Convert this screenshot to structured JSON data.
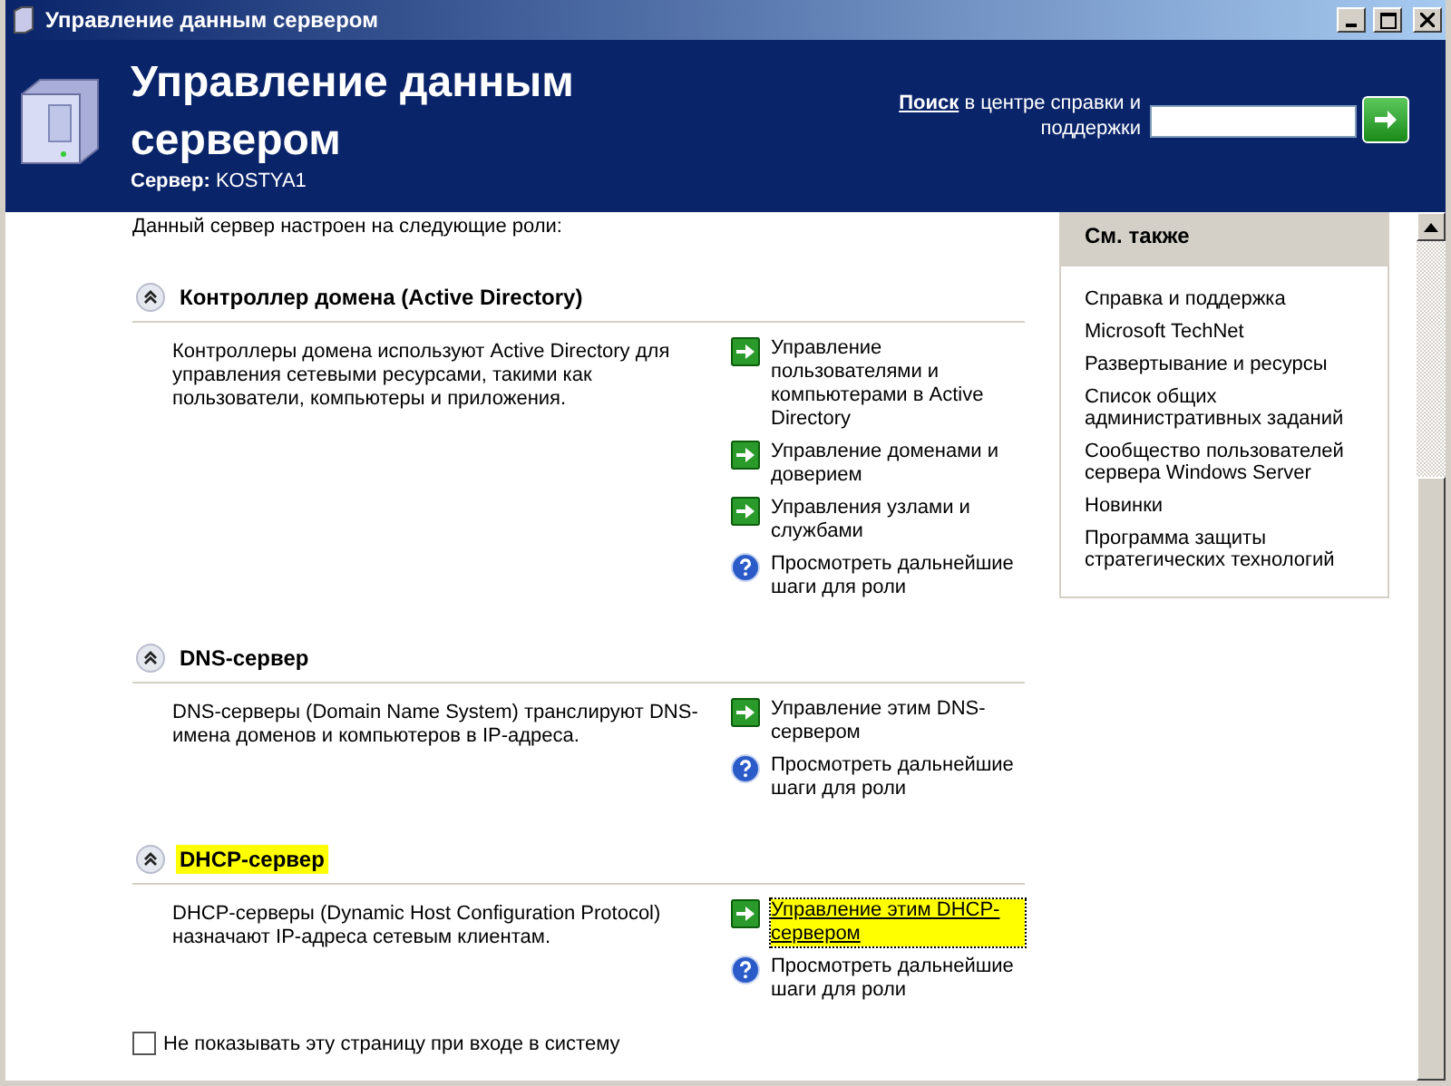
{
  "window": {
    "title": "Управление данным сервером"
  },
  "header": {
    "title": "Управление данным сервером",
    "server_label": "Сервер:",
    "server_name": "KOSTYA1",
    "search_label": "Поиск",
    "search_hint": "в центре справки и поддержки"
  },
  "intro": "Данный сервер настроен на следующие роли:",
  "roles": [
    {
      "title": "Контроллер домена (Active Directory)",
      "expanded": true,
      "highlighted": false,
      "description": "Контроллеры домена используют Active Directory для управления сетевыми ресурсами, такими как пользователи, компьютеры и приложения.",
      "actions": [
        {
          "kind": "manage",
          "label": "Управление пользователями и компьютерами в Active Directory",
          "highlighted": false
        },
        {
          "kind": "manage",
          "label": "Управление доменами и доверием",
          "highlighted": false
        },
        {
          "kind": "manage",
          "label": "Управления узлами и службами",
          "highlighted": false
        },
        {
          "kind": "help",
          "label": "Просмотреть дальнейшие шаги для роли",
          "highlighted": false
        }
      ]
    },
    {
      "title": "DNS-сервер",
      "expanded": true,
      "highlighted": false,
      "description": "DNS-серверы (Domain Name System) транслируют DNS-имена доменов и компьютеров в IP-адреса.",
      "actions": [
        {
          "kind": "manage",
          "label": "Управление этим DNS-сервером",
          "highlighted": false
        },
        {
          "kind": "help",
          "label": "Просмотреть дальнейшие шаги для роли",
          "highlighted": false
        }
      ]
    },
    {
      "title": "DHCP-сервер",
      "expanded": true,
      "highlighted": true,
      "description": "DHCP-серверы (Dynamic Host Configuration Protocol) назначают IP-адреса сетевым клиентам.",
      "actions": [
        {
          "kind": "manage",
          "label": "Управление этим DHCP-сервером",
          "highlighted": true
        },
        {
          "kind": "help",
          "label": "Просмотреть дальнейшие шаги для роли",
          "highlighted": false
        }
      ]
    }
  ],
  "dont_show": {
    "label": "Не показывать эту страницу при входе в систему",
    "checked": false
  },
  "see_also": {
    "title": "См. также",
    "links": [
      "Справка и поддержка",
      "Microsoft TechNet",
      "Развертывание и ресурсы",
      "Список общих административных заданий",
      "Сообщество пользователей сервера Windows Server",
      "Новинки",
      "Программа защиты стратегических технологий"
    ]
  }
}
